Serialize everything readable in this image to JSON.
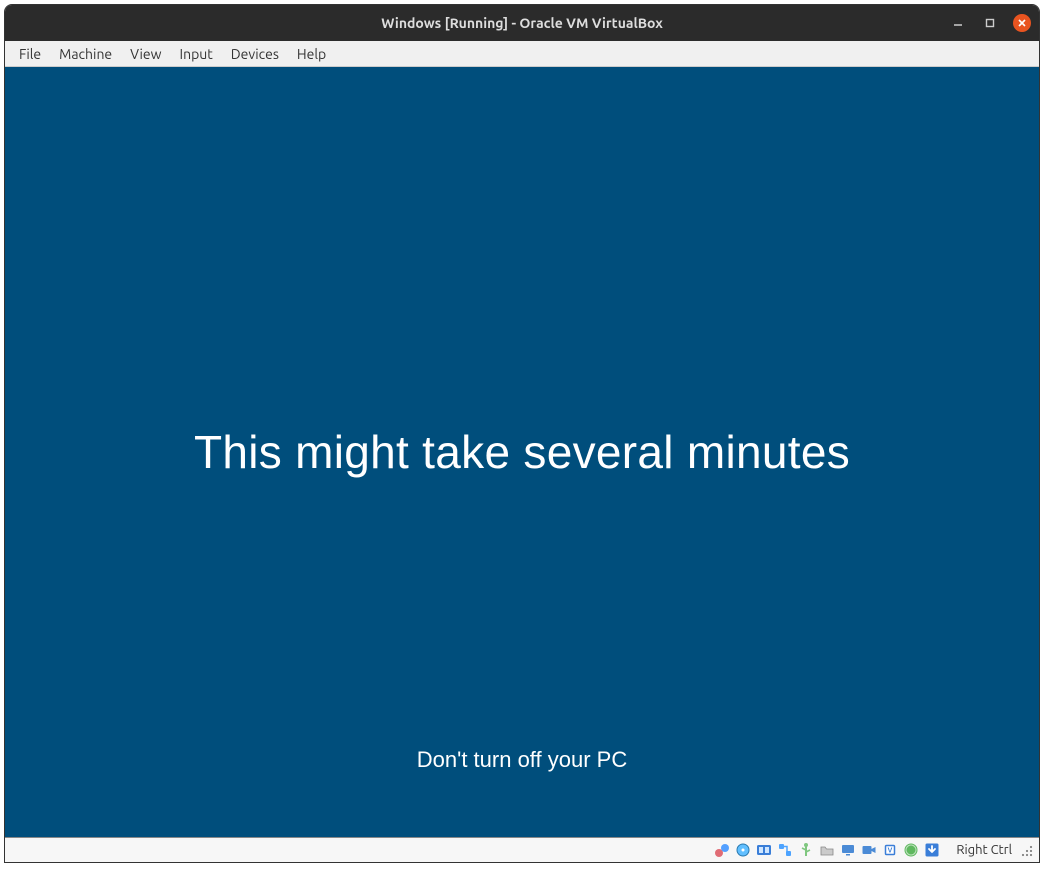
{
  "window": {
    "title": "Windows [Running] - Oracle VM VirtualBox"
  },
  "menubar": {
    "items": [
      "File",
      "Machine",
      "View",
      "Input",
      "Devices",
      "Help"
    ]
  },
  "guest": {
    "main_message": "This might take several minutes",
    "sub_message": "Don't turn off your PC"
  },
  "statusbar": {
    "icons": [
      "hard-disk-icon",
      "optical-disk-icon",
      "audio-icon",
      "network-icon",
      "usb-icon",
      "shared-folders-icon",
      "display-icon",
      "recording-icon",
      "cpu-icon",
      "mouse-integration-icon",
      "keyboard-capture-icon"
    ],
    "hostkey": "Right Ctrl"
  }
}
